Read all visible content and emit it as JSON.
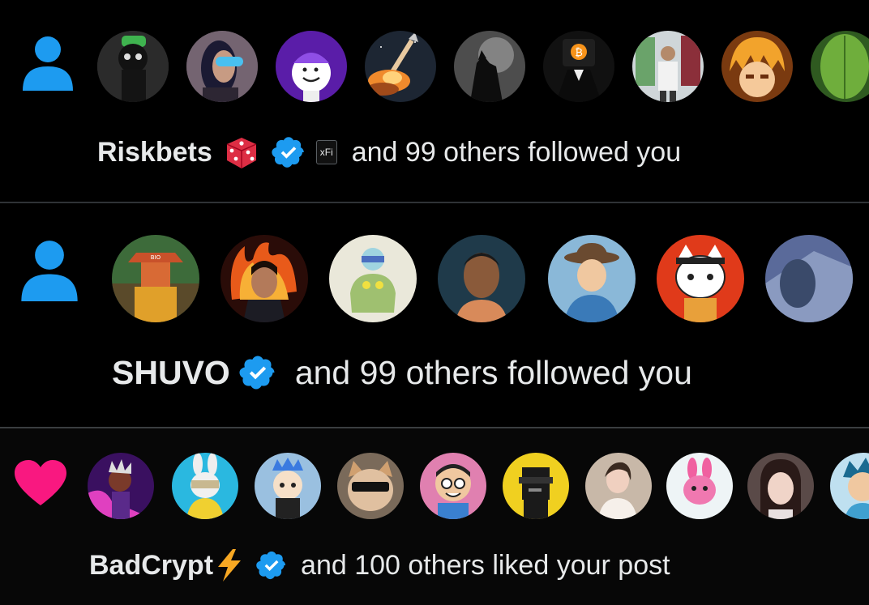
{
  "notifications": [
    {
      "type": "follow",
      "icon": "person-icon",
      "icon_color": "#1d9bf0",
      "avatars": [
        "avatar-1",
        "avatar-2",
        "avatar-3",
        "avatar-4",
        "avatar-5",
        "avatar-6",
        "avatar-7",
        "avatar-8",
        "avatar-9"
      ],
      "name": "Riskbets",
      "name_emoji": "die-emoji",
      "affiliate_badge": "xFi",
      "rest_text": "and 99 others followed you"
    },
    {
      "type": "follow",
      "icon": "person-icon",
      "icon_color": "#1d9bf0",
      "avatars": [
        "avatar-1",
        "avatar-2",
        "avatar-3",
        "avatar-4",
        "avatar-5",
        "avatar-6",
        "avatar-7"
      ],
      "name": "SHUVO",
      "rest_text": "and 99 others followed you"
    },
    {
      "type": "like",
      "icon": "heart-icon",
      "icon_color": "#f91880",
      "avatars": [
        "avatar-1",
        "avatar-2",
        "avatar-3",
        "avatar-4",
        "avatar-5",
        "avatar-6",
        "avatar-7",
        "avatar-8",
        "avatar-9",
        "avatar-10"
      ],
      "name": "BadCrypt",
      "name_emoji": "lightning-emoji",
      "rest_text": "and 100 others liked your post"
    }
  ],
  "colors": {
    "background": "#000000",
    "verified": "#1d9bf0",
    "text": "#e7e9ea",
    "divider": "#2f3336"
  }
}
